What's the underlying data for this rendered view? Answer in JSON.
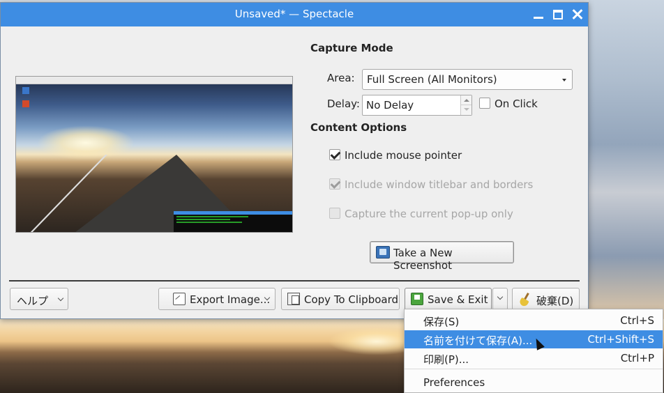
{
  "window": {
    "title": "Unsaved* — Spectacle"
  },
  "capture": {
    "heading": "Capture Mode",
    "area_label": "Area:",
    "area_value": "Full Screen (All Monitors)",
    "delay_label": "Delay:",
    "delay_value": "No Delay",
    "on_click_label": "On Click"
  },
  "content": {
    "heading": "Content Options",
    "include_pointer": "Include mouse pointer",
    "include_titlebar": "Include window titlebar and borders",
    "popup_only": "Capture the current pop-up only"
  },
  "buttons": {
    "new_screenshot": "Take a New Screenshot",
    "help": "ヘルプ",
    "export": "Export Image...",
    "clipboard": "Copy To Clipboard",
    "save_exit": "Save & Exit",
    "discard": "破棄(D)"
  },
  "menu": {
    "items": [
      {
        "label": "保存(S)",
        "shortcut": "Ctrl+S"
      },
      {
        "label": "名前を付けて保存(A)...",
        "shortcut": "Ctrl+Shift+S"
      },
      {
        "label": "印刷(P)...",
        "shortcut": "Ctrl+P"
      },
      {
        "label": "Preferences",
        "shortcut": ""
      }
    ]
  },
  "colors": {
    "accent": "#3e8de3"
  }
}
